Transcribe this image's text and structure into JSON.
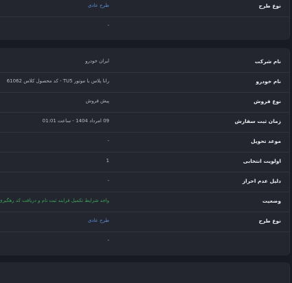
{
  "top_card": {
    "design_type_label": "نوع طرح",
    "design_type_value": "طرح عادی",
    "dash": "-"
  },
  "main_card": {
    "company_label": "نام شرکت",
    "company_value": "ایران خودرو",
    "car_name_label": "نام خودرو",
    "car_name_value": "رانا پلاس با موتور TU5 - کد محصول کلاس 61062",
    "sale_type_label": "نوع فروش",
    "sale_type_value": "پیش فروش",
    "order_time_label": "زمان ثبت سفارش",
    "order_time_value": "09 امرداد 1404 - ساعت 01:01",
    "delivery_label": "موعد تحویل",
    "delivery_value": "-",
    "priority_label": "اولویت انتخابی",
    "priority_value": "1",
    "reject_reason_label": "دلیل عدم احراز",
    "reject_reason_value": "-",
    "status_label": "وضعیت",
    "status_value": "واجد شرایط تکمیل فرایند ثبت نام و دریافت کد رهگیری",
    "design_type_label": "نوع طرح",
    "design_type_value": "طرح عادی",
    "dash": "-"
  }
}
